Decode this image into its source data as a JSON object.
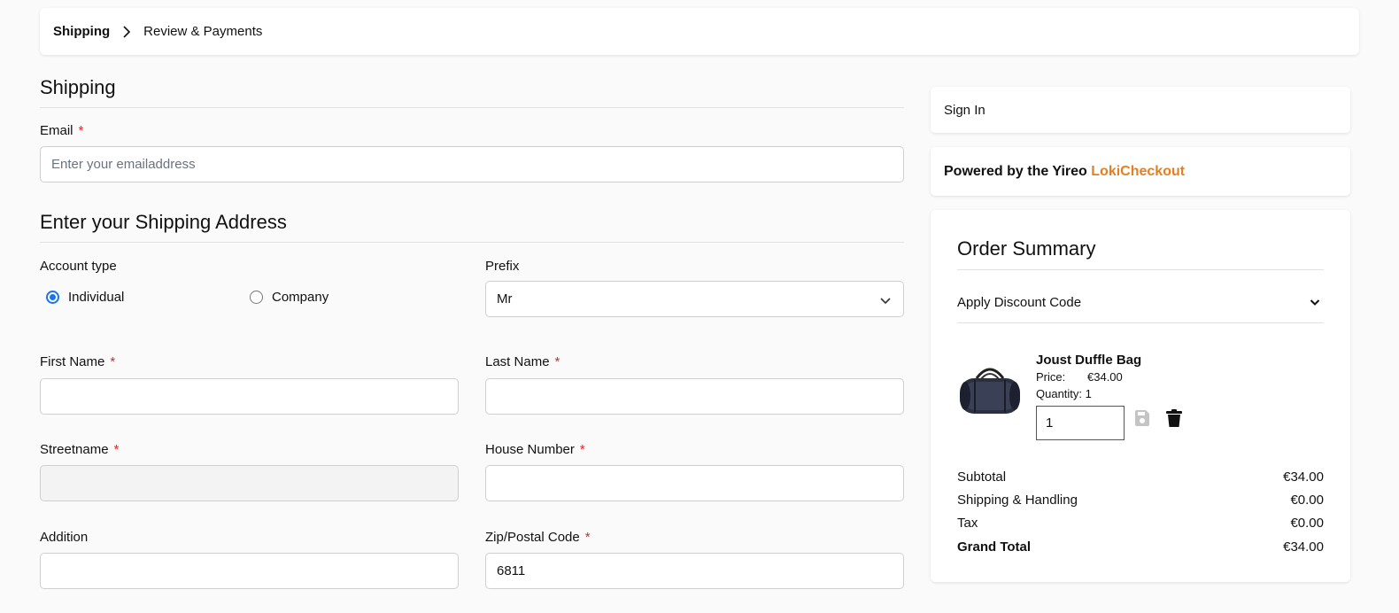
{
  "breadcrumb": {
    "current": "Shipping",
    "next": "Review & Payments"
  },
  "shipping": {
    "title": "Shipping",
    "email_label": "Email",
    "email_placeholder": "Enter your emailaddress",
    "required_mark": "*"
  },
  "address": {
    "title": "Enter your Shipping Address",
    "account_type_label": "Account type",
    "account_types": [
      "Individual",
      "Company"
    ],
    "selected_account_type": "Individual",
    "prefix_label": "Prefix",
    "prefix_value": "Mr",
    "first_name_label": "First Name",
    "first_name_value": "",
    "last_name_label": "Last Name",
    "last_name_value": "",
    "street_label": "Streetname",
    "street_value": "",
    "house_number_label": "House Number",
    "house_number_value": "",
    "addition_label": "Addition",
    "addition_value": "",
    "zip_label": "Zip/Postal Code",
    "zip_value": "6811"
  },
  "sidebar": {
    "sign_in": "Sign In",
    "powered_prefix": "Powered by the Yireo",
    "powered_brand": "LokiCheckout",
    "brand_color": "#e67e22"
  },
  "order_summary": {
    "title": "Order Summary",
    "discount_label": "Apply Discount Code",
    "item": {
      "name": "Joust Duffle Bag",
      "price_label": "Price:",
      "price": "€34.00",
      "qty_label": "Quantity:",
      "qty": "1",
      "qty_input": "1"
    },
    "totals": [
      {
        "label": "Subtotal",
        "value": "€34.00"
      },
      {
        "label": "Shipping & Handling",
        "value": "€0.00"
      },
      {
        "label": "Tax",
        "value": "€0.00"
      }
    ],
    "grand_total": {
      "label": "Grand Total",
      "value": "€34.00"
    }
  }
}
